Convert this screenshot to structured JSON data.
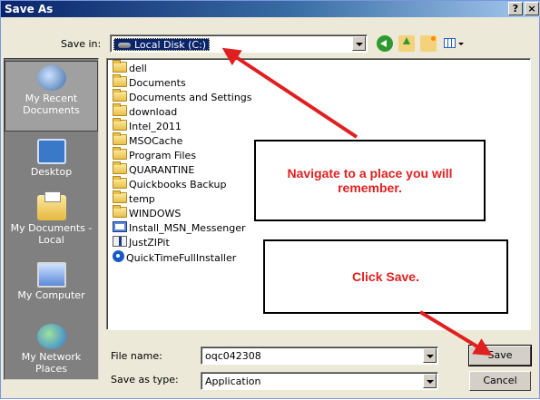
{
  "window": {
    "title": "Save As",
    "help_btn": "?",
    "close_btn": "×"
  },
  "save_in": {
    "label": "Save in:",
    "value": "Local Disk (C:)"
  },
  "toolbar": [
    "back-icon",
    "up-folder-icon",
    "new-folder-icon",
    "views-menu-icon"
  ],
  "places": [
    {
      "label": "My Recent Documents",
      "icon": "recent-documents-icon"
    },
    {
      "label": "Desktop",
      "icon": "desktop-icon"
    },
    {
      "label": "My Documents - Local",
      "icon": "my-documents-icon"
    },
    {
      "label": "My Computer",
      "icon": "my-computer-icon"
    },
    {
      "label": "My Network Places",
      "icon": "network-places-icon"
    }
  ],
  "files": [
    {
      "name": "dell",
      "type": "folder"
    },
    {
      "name": "Documents",
      "type": "folder"
    },
    {
      "name": "Documents and Settings",
      "type": "folder"
    },
    {
      "name": "download",
      "type": "folder"
    },
    {
      "name": "Intel_2011",
      "type": "folder"
    },
    {
      "name": "MSOCache",
      "type": "folder"
    },
    {
      "name": "Program Files",
      "type": "folder"
    },
    {
      "name": "QUARANTINE",
      "type": "folder"
    },
    {
      "name": "Quickbooks Backup",
      "type": "folder"
    },
    {
      "name": "temp",
      "type": "folder"
    },
    {
      "name": "WINDOWS",
      "type": "folder"
    },
    {
      "name": "Install_MSN_Messenger",
      "type": "app"
    },
    {
      "name": "JustZIPit",
      "type": "zip"
    },
    {
      "name": "QuickTimeFullInstaller",
      "type": "qt"
    }
  ],
  "callouts": {
    "navigate": "Navigate to a place you will remember.",
    "click_save": "Click Save."
  },
  "filename": {
    "label": "File name:",
    "value": "oqc042308"
  },
  "filetype": {
    "label": "Save as type:",
    "value": "Application"
  },
  "buttons": {
    "save": "Save",
    "cancel": "Cancel"
  },
  "colors": {
    "annotation_red": "#e02020",
    "titlebar_blue": "#0a246a"
  }
}
